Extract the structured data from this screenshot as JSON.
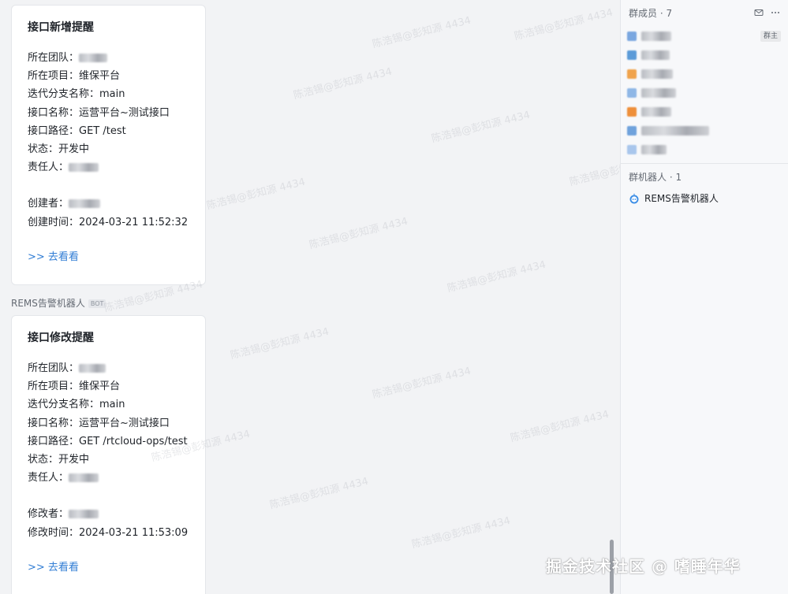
{
  "cards": [
    {
      "title": "接口新增提醒",
      "fields": [
        {
          "label": "所在团队：",
          "value": ""
        },
        {
          "label": "所在项目：",
          "value": "维保平台"
        },
        {
          "label": "迭代分支名称：",
          "value": "main"
        },
        {
          "label": "接口名称：",
          "value": "运营平台~测试接口"
        },
        {
          "label": "接口路径：",
          "value": "GET /test"
        },
        {
          "label": "状态：",
          "value": "开发中"
        },
        {
          "label": "责任人：",
          "value": ""
        }
      ],
      "meta": [
        {
          "label": "创建者：",
          "value": ""
        },
        {
          "label": "创建时间：",
          "value": "2024-03-21 11:52:32"
        }
      ],
      "link": ">> 去看看"
    },
    {
      "title": "接口修改提醒",
      "fields": [
        {
          "label": "所在团队：",
          "value": ""
        },
        {
          "label": "所在项目：",
          "value": "维保平台"
        },
        {
          "label": "迭代分支名称：",
          "value": "main"
        },
        {
          "label": "接口名称：",
          "value": "运营平台~测试接口"
        },
        {
          "label": "接口路径：",
          "value": "GET /rtcloud-ops/test"
        },
        {
          "label": "状态：",
          "value": "开发中"
        },
        {
          "label": "责任人：",
          "value": ""
        }
      ],
      "meta": [
        {
          "label": "修改者：",
          "value": ""
        },
        {
          "label": "修改时间：",
          "value": "2024-03-21 11:53:09"
        }
      ],
      "link": ">> 去看看"
    }
  ],
  "sender": {
    "name": "REMS告警机器人",
    "badge": "BOT"
  },
  "watermark": "陈浩锡@彭知源 4434",
  "side_panel": {
    "members_title": "群成员 · 7",
    "owner_badge": "群主",
    "bots_title": "群机器人 · 1",
    "bot_name": "REMS告警机器人"
  },
  "footer": "掘金技术社区 @ 嗜睡年华",
  "colors": {
    "link": "#2f7cd4",
    "panel_bg": "#f7f8fa",
    "chat_bg": "#f2f3f5"
  }
}
